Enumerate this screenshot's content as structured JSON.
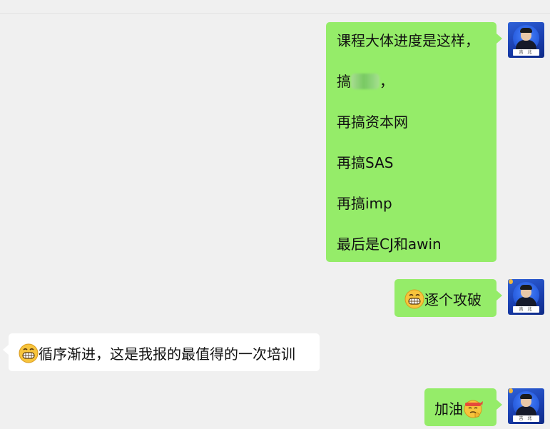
{
  "messages": [
    {
      "side": "right",
      "lines": [
        "课程大体进度是这样，",
        "搞",
        "，",
        "再搞资本网",
        "再搞SAS",
        "再搞imp",
        "最后是CJ和awin"
      ]
    },
    {
      "side": "right",
      "text": "逐个攻破",
      "emoji": "grinning-face-emoji"
    },
    {
      "side": "left",
      "text": "循序渐进，这是我报的最值得的一次培训",
      "emoji": "grinning-face-emoji"
    },
    {
      "side": "right",
      "text": "加油",
      "emoji": "fighting-headband-emoji"
    }
  ],
  "bubble_colors": {
    "sent": "#95ec69",
    "received": "#ffffff",
    "background": "#f0f0f0"
  },
  "avatar": {
    "name_plate": "吉 北"
  }
}
